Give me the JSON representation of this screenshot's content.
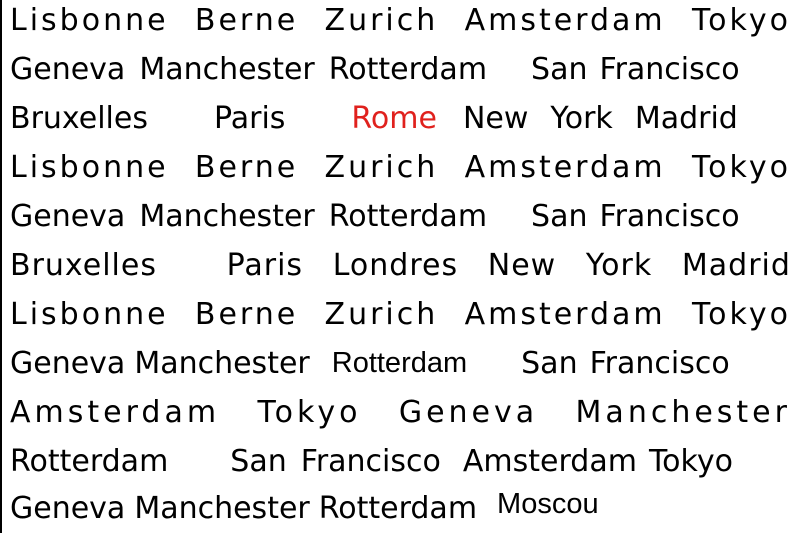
{
  "lines": [
    [
      "Lisbonne",
      "Berne",
      "Zurich",
      "Amsterdam",
      "Tokyo"
    ],
    [
      "Geneva",
      "Manchester",
      "Rotterdam",
      "San",
      "Francisco"
    ],
    [
      "Bruxelles",
      "Paris",
      "Rome",
      "New",
      "York",
      "Madrid"
    ],
    [
      "Lisbonne",
      "Berne",
      "Zurich",
      "Amsterdam",
      "Tokyo"
    ],
    [
      "Geneva",
      "Manchester",
      "Rotterdam",
      "San",
      "Francisco"
    ],
    [
      "Bruxelles",
      "Paris",
      "Londres",
      "New",
      "York",
      "Madrid"
    ],
    [
      "Lisbonne",
      "Berne",
      "Zurich",
      "Amsterdam",
      "Tokyo"
    ],
    [
      "Geneva",
      "Manchester",
      "Rotterdam",
      "San",
      "Francisco"
    ],
    [
      "Amsterdam",
      "Tokyo",
      "Geneva",
      "Manchester"
    ],
    [
      "Rotterdam",
      "San",
      "Francisco",
      "Amsterdam",
      "Tokyo"
    ],
    [
      "Geneva",
      "Manchester",
      "Rotterdam",
      "Moscou"
    ]
  ],
  "highlight_color": "#e0211d"
}
